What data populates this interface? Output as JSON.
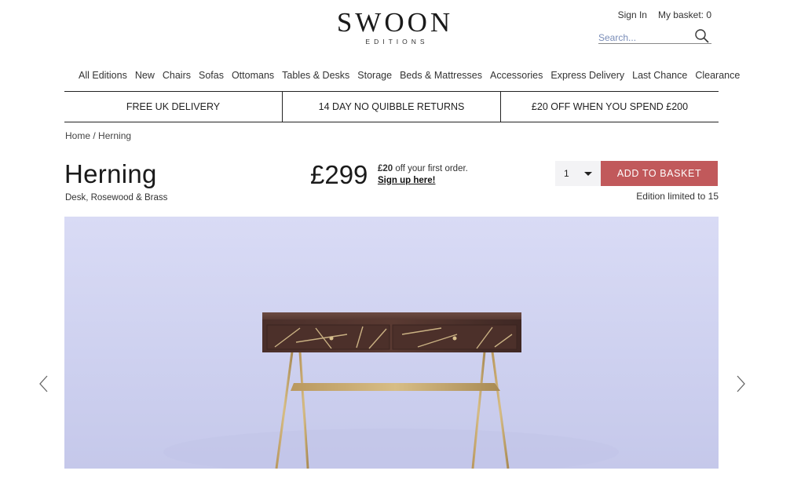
{
  "brand": {
    "name": "SWOON",
    "sub": "EDITIONS"
  },
  "header": {
    "sign_in": "Sign In",
    "basket": "My basket: 0",
    "search_placeholder": "Search..."
  },
  "nav": {
    "items": [
      "All Editions",
      "New",
      "Chairs",
      "Sofas",
      "Ottomans",
      "Tables & Desks",
      "Storage",
      "Beds & Mattresses",
      "Accessories",
      "Express Delivery",
      "Last Chance",
      "Clearance"
    ]
  },
  "usp": [
    "FREE UK DELIVERY",
    "14 DAY NO QUIBBLE RETURNS",
    "£20 OFF WHEN YOU SPEND £200"
  ],
  "breadcrumb": {
    "home": "Home",
    "separator": " / ",
    "current": "Herning"
  },
  "product": {
    "name": "Herning",
    "subtitle": "Desk, Rosewood & Brass",
    "price": "£299",
    "promo_amount": "£20",
    "promo_text": " off your first order.",
    "promo_link": "Sign up here!",
    "quantity": "1",
    "add_label": "ADD TO BASKET",
    "edition": "Edition limited to 15"
  },
  "colors": {
    "accent_button": "#c1595b",
    "hero_background": "#d2d4f0",
    "search_text": "#7a8db8"
  },
  "icons": {
    "search": "search-icon",
    "prev": "chevron-left-icon",
    "next": "chevron-right-icon",
    "dropdown": "caret-down-icon"
  }
}
